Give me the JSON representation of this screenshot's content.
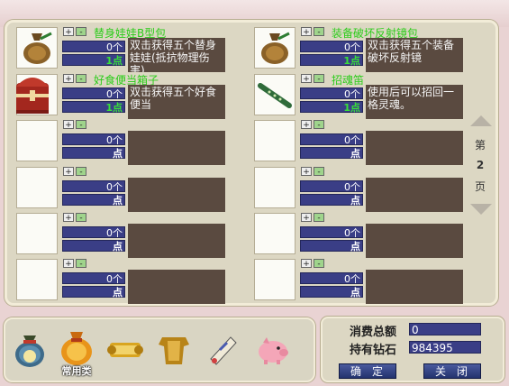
{
  "slots": [
    {
      "name": "替身娃娃B型包",
      "desc": "双击获得五个替身娃娃(抵抗物理伤害)",
      "qty": "0个",
      "count": "1点",
      "icon": "pouch-icon"
    },
    {
      "name": "装备破坏反射镜包",
      "desc": "双击获得五个装备破坏反射镜",
      "qty": "0个",
      "count": "1点",
      "icon": "pouch-icon"
    },
    {
      "name": "好食便当箱子",
      "desc": "双击获得五个好食便当",
      "qty": "0个",
      "count": "1点",
      "icon": "treasure-chest-icon"
    },
    {
      "name": "招魂笛",
      "desc": "使用后可以招回一格灵魂。",
      "qty": "0个",
      "count": "1点",
      "icon": "flute-icon"
    },
    {
      "name": "",
      "desc": "",
      "qty": "0个",
      "count": "点"
    },
    {
      "name": "",
      "desc": "",
      "qty": "0个",
      "count": "点"
    },
    {
      "name": "",
      "desc": "",
      "qty": "0个",
      "count": "点"
    },
    {
      "name": "",
      "desc": "",
      "qty": "0个",
      "count": "点"
    },
    {
      "name": "",
      "desc": "",
      "qty": "0个",
      "count": "点"
    },
    {
      "name": "",
      "desc": "",
      "qty": "0个",
      "count": "点"
    },
    {
      "name": "",
      "desc": "",
      "qty": "0个",
      "count": "点"
    },
    {
      "name": "",
      "desc": "",
      "qty": "0个",
      "count": "点"
    }
  ],
  "controls": {
    "plus": "+",
    "minus": "-"
  },
  "pager": {
    "prefix": "第",
    "page": "2",
    "suffix": "页"
  },
  "tabs": [
    {
      "icon": "lucky-bag-icon",
      "label": ""
    },
    {
      "icon": "money-bag-icon",
      "label": "常用类"
    },
    {
      "icon": "golden-scroll-icon",
      "label": ""
    },
    {
      "icon": "golden-armor-icon",
      "label": ""
    },
    {
      "icon": "fan-scroll-icon",
      "label": ""
    },
    {
      "icon": "pink-pig-icon",
      "label": ""
    }
  ],
  "info": {
    "total_label": "消费总额",
    "total_value": "0",
    "diamond_label": "持有钻石",
    "diamond_value": "984395"
  },
  "buttons": {
    "ok": "确定",
    "close": "关闭"
  },
  "colors": {
    "item_name": "#2bcc1a",
    "qty_field": "#3a3e86",
    "desc_bg": "#5a4a40",
    "panel_bg": "#dcd7c3"
  }
}
